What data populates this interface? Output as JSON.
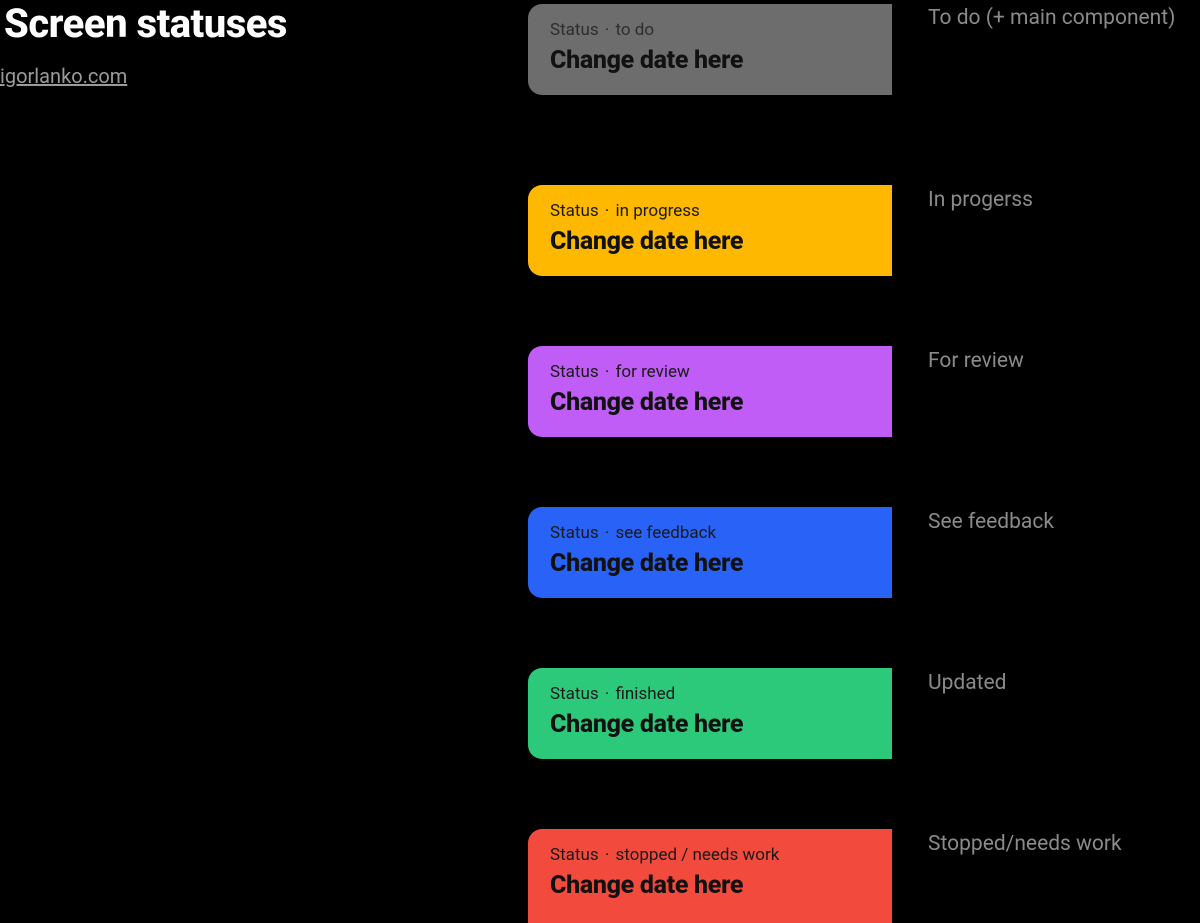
{
  "header": {
    "title": "Screen statuses",
    "author_link": "igorlanko.com"
  },
  "status_prefix": "Status",
  "separator": "·",
  "change_date_text": "Change date here",
  "statuses": [
    {
      "status_name": "to do",
      "row_label": "To do (+ main component)",
      "bg_color": "#6d6d6d"
    },
    {
      "status_name": "in progress",
      "row_label": "In progerss",
      "bg_color": "#ffb800"
    },
    {
      "status_name": "for review",
      "row_label": "For review",
      "bg_color": "#c05df6"
    },
    {
      "status_name": "see feedback",
      "row_label": "See feedback",
      "bg_color": "#2962f6"
    },
    {
      "status_name": "finished",
      "row_label": "Updated",
      "bg_color": "#2dc97a"
    },
    {
      "status_name": "stopped / needs work",
      "row_label": "Stopped/needs work",
      "bg_color": "#f24a3d"
    }
  ]
}
